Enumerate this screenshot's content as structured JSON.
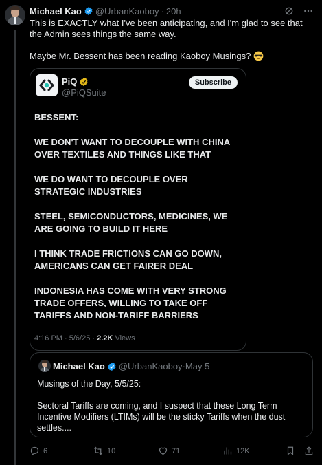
{
  "tweet": {
    "author_name": "Michael Kao",
    "author_handle": "@UrbanKaoboy",
    "time": "20h",
    "separator": "·",
    "text_line1": "This is EXACTLY what I've been anticipating, and I'm glad to see that the Admin sees things the same way.",
    "text_line2": "Maybe Mr. Bessent has been reading Kaoboy Musings?",
    "emoji": "sunglasses-emoji"
  },
  "embedded": {
    "name": "PiQ",
    "handle": "@PiQSuite",
    "subscribe_label": "Subscribe",
    "paragraphs": [
      "BESSENT:",
      "WE DON'T WANT TO DECOUPLE WITH CHINA OVER TEXTILES AND THINGS LIKE THAT",
      "WE DO WANT TO DECOUPLE OVER STRATEGIC INDUSTRIES",
      "STEEL, SEMICONDUCTORS, MEDICINES, WE ARE GOING TO BUILD IT HERE",
      "I THINK TRADE FRICTIONS CAN GO DOWN, AMERICANS CAN GET FAIRER DEAL",
      "INDONESIA HAS COME WITH VERY STRONG TRADE OFFERS, WILLING TO TAKE OFF TARIFFS AND NON-TARIFF BARRIERS"
    ],
    "time": "4:16 PM",
    "date": "5/6/25",
    "separator": " · ",
    "views_count": "2.2K",
    "views_label": "Views"
  },
  "quoted": {
    "author_name": "Michael Kao",
    "author_handle": "@UrbanKaoboy",
    "date": "May 5",
    "separator": " · ",
    "text_line1": "Musings of the Day, 5/5/25:",
    "text_line2": "Sectoral Tariffs are coming, and I suspect that these Long Term Incentive Modifiers (LTIMs) will be the sticky Tariffs when the dust settles...."
  },
  "actions": {
    "replies": "6",
    "retweets": "10",
    "likes": "71",
    "views": "12K"
  },
  "colors": {
    "background": "#000000",
    "text": "#e7e9ea",
    "secondary": "#71767b",
    "verified_blue": "#1d9bf0",
    "verified_gold": "#e2b719",
    "border": "#2f3336"
  }
}
